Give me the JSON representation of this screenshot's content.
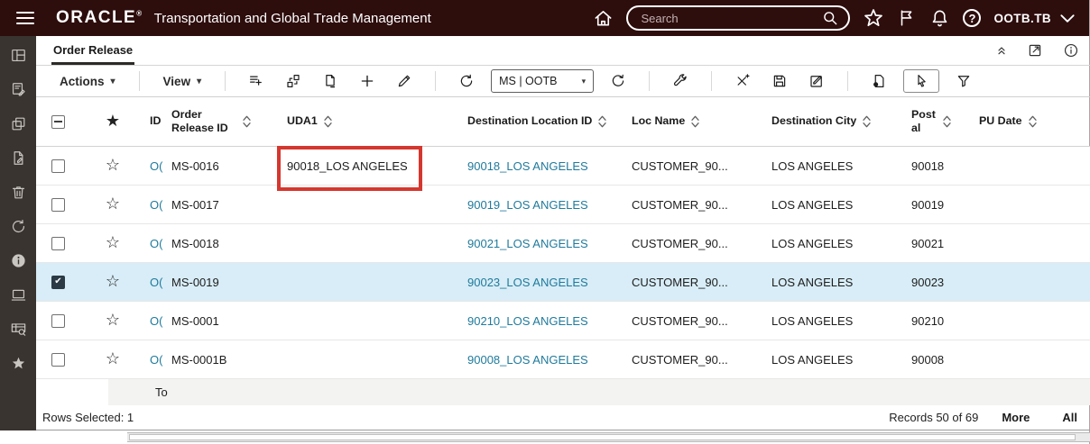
{
  "topbar": {
    "brand": "ORACLE",
    "app_title": "Transportation and Global Trade Management",
    "search_placeholder": "Search",
    "user_menu": "OOTB.TB"
  },
  "sidebar": {
    "icons": [
      "dashboard",
      "edit-note",
      "copy",
      "document-edit",
      "trash",
      "refresh",
      "info",
      "monitor",
      "table-search",
      "favorites"
    ]
  },
  "page": {
    "tab_label": "Order Release"
  },
  "toolbar": {
    "actions_label": "Actions",
    "view_label": "View",
    "saved_search_value": "MS | OOTB"
  },
  "table": {
    "columns": [
      {
        "key": "id_text",
        "label": "ID",
        "sortable": false
      },
      {
        "key": "order_release_id",
        "label": "Order Release ID",
        "sortable": true
      },
      {
        "key": "uda1",
        "label": "UDA1",
        "sortable": true
      },
      {
        "key": "dest_loc_id",
        "label": "Destination Location ID",
        "sortable": true
      },
      {
        "key": "loc_name",
        "label": "Loc Name",
        "sortable": true
      },
      {
        "key": "dest_city",
        "label": "Destination City",
        "sortable": true
      },
      {
        "key": "postal",
        "label": "Postal",
        "sortable": true
      },
      {
        "key": "pu_date",
        "label": "PU Date",
        "sortable": true
      }
    ],
    "rows": [
      {
        "selected": false,
        "id_text": "O(",
        "order_release_id": "MS-0016",
        "uda1": "90018_LOS ANGELES",
        "dest_loc_id": "90018_LOS ANGELES",
        "loc_name": "CUSTOMER_90...",
        "dest_city": "LOS ANGELES",
        "postal": "90018",
        "pu_date": ""
      },
      {
        "selected": false,
        "id_text": "O(",
        "order_release_id": "MS-0017",
        "uda1": "",
        "dest_loc_id": "90019_LOS ANGELES",
        "loc_name": "CUSTOMER_90...",
        "dest_city": "LOS ANGELES",
        "postal": "90019",
        "pu_date": ""
      },
      {
        "selected": false,
        "id_text": "O(",
        "order_release_id": "MS-0018",
        "uda1": "",
        "dest_loc_id": "90021_LOS ANGELES",
        "loc_name": "CUSTOMER_90...",
        "dest_city": "LOS ANGELES",
        "postal": "90021",
        "pu_date": ""
      },
      {
        "selected": true,
        "id_text": "O(",
        "order_release_id": "MS-0019",
        "uda1": "",
        "dest_loc_id": "90023_LOS ANGELES",
        "loc_name": "CUSTOMER_90...",
        "dest_city": "LOS ANGELES",
        "postal": "90023",
        "pu_date": ""
      },
      {
        "selected": false,
        "id_text": "O(",
        "order_release_id": "MS-0001",
        "uda1": "",
        "dest_loc_id": "90210_LOS ANGELES",
        "loc_name": "CUSTOMER_90...",
        "dest_city": "LOS ANGELES",
        "postal": "90210",
        "pu_date": ""
      },
      {
        "selected": false,
        "id_text": "O(",
        "order_release_id": "MS-0001B",
        "uda1": "",
        "dest_loc_id": "90008_LOS ANGELES",
        "loc_name": "CUSTOMER_90...",
        "dest_city": "LOS ANGELES",
        "postal": "90008",
        "pu_date": ""
      }
    ],
    "partial_next_row_text": "To"
  },
  "footer": {
    "rows_selected": "Rows Selected: 1",
    "records": "Records 50 of 69",
    "more_label": "More",
    "all_label": "All"
  },
  "annotation": {
    "target": "uda1-value-row-1",
    "color": "#d5372f"
  },
  "colors": {
    "topbar_bg": "#2e0d0d",
    "sidebar_bg": "#393430",
    "link": "#1f7a9c",
    "selected_row_bg": "#d8edf7",
    "annotation": "#d5372f"
  }
}
